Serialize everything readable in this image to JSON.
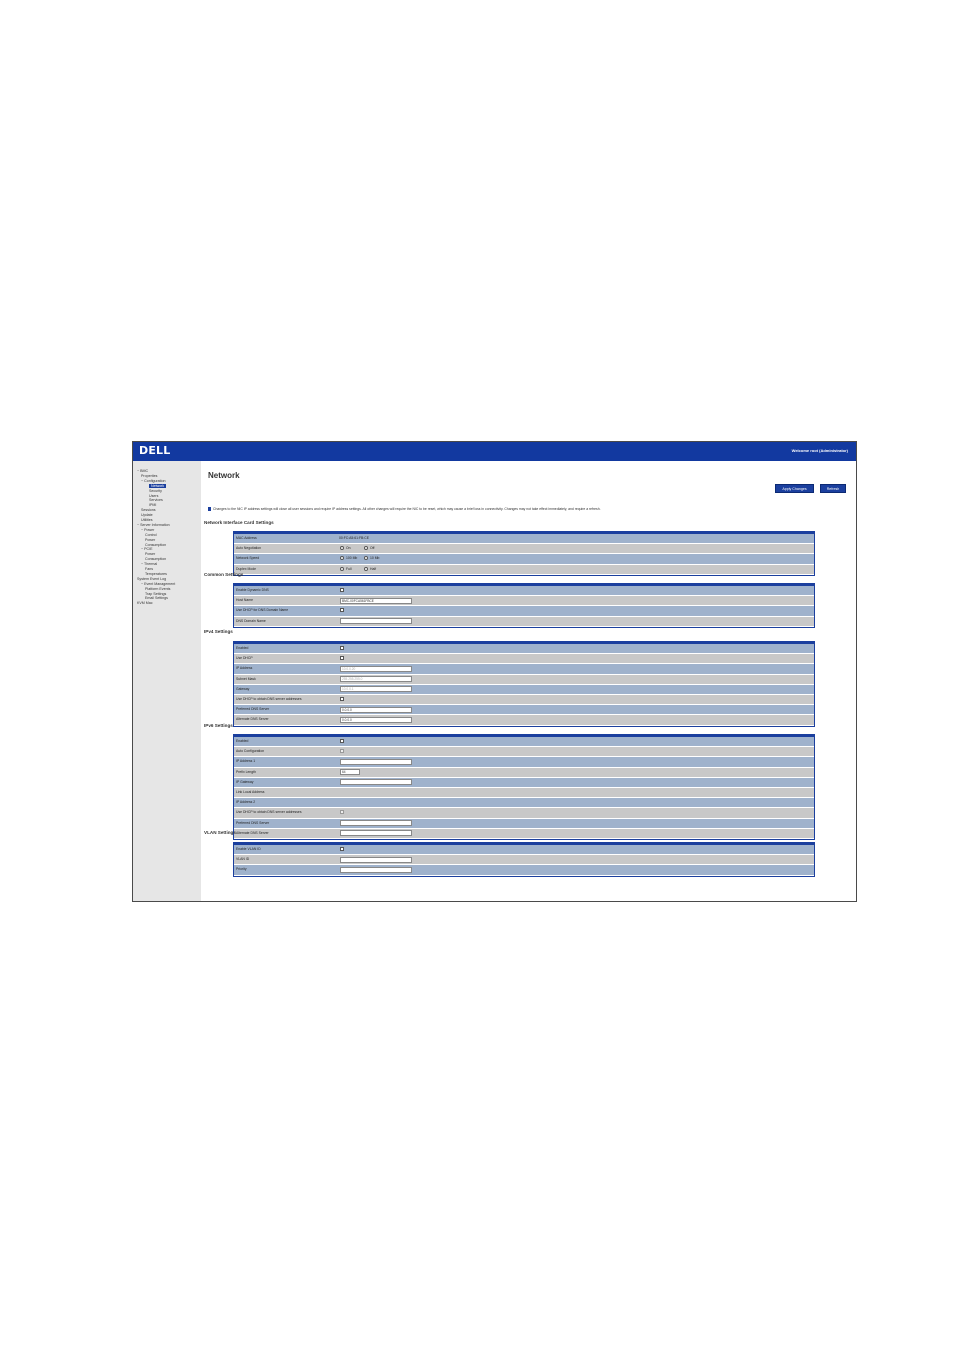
{
  "header": {
    "logo": "DELL",
    "welcome": "Welcome root (Administrator)"
  },
  "sidebar": {
    "items": [
      {
        "label": "− BMC",
        "indent": 0
      },
      {
        "label": "Properties",
        "indent": 1
      },
      {
        "label": "− Configuration",
        "indent": 1
      },
      {
        "label": "Network",
        "indent": 3,
        "active": true
      },
      {
        "label": "Security",
        "indent": 3
      },
      {
        "label": "Users",
        "indent": 3
      },
      {
        "label": "Services",
        "indent": 3
      },
      {
        "label": "IPMI",
        "indent": 3
      },
      {
        "label": "Sessions",
        "indent": 1
      },
      {
        "label": "Update",
        "indent": 1
      },
      {
        "label": "Utilities",
        "indent": 1
      },
      {
        "label": "− Server Information",
        "indent": 0
      },
      {
        "label": "− Power",
        "indent": 1
      },
      {
        "label": "Control",
        "indent": 2
      },
      {
        "label": "Power",
        "indent": 2
      },
      {
        "label": "Consumption",
        "indent": 2
      },
      {
        "label": "− PCIE",
        "indent": 1
      },
      {
        "label": "Power",
        "indent": 2
      },
      {
        "label": "Consumption",
        "indent": 2
      },
      {
        "label": "− Thermal",
        "indent": 1
      },
      {
        "label": "Fans",
        "indent": 2
      },
      {
        "label": "Temperatures",
        "indent": 2
      },
      {
        "label": "System Event Log",
        "indent": 0
      },
      {
        "label": "− Event Management",
        "indent": 1
      },
      {
        "label": "Platform Events",
        "indent": 2
      },
      {
        "label": "Trap Settings",
        "indent": 2
      },
      {
        "label": "Email Settings",
        "indent": 2
      },
      {
        "label": "KVM Mac",
        "indent": 0
      }
    ]
  },
  "main": {
    "title": "Network",
    "apply_label": "Apply Changes",
    "refresh_label": "Refresh",
    "notice": "Changes to the NIC IP address settings will close all user sessions and require IP address settings. All other changes will require the NIC to be reset, which may cause a brief loss in connectivity. Changes may not take effect immediately, and require a refresh."
  },
  "nic": {
    "title": "Network Interface Card Settings",
    "rows": [
      {
        "label": "MAC Address",
        "value": "00:FC:A5:61:FB:CE"
      },
      {
        "label": "Auto Negotiation",
        "on": "On",
        "off": "Off"
      },
      {
        "label": "Network Speed",
        "speed1": "100 Mb",
        "speed2": "10 Mb"
      },
      {
        "label": "Duplex Mode",
        "duplex1": "Full",
        "duplex2": "Half"
      }
    ]
  },
  "common": {
    "title": "Common Settings",
    "rows": [
      {
        "label": "Enable Dynamic DNS"
      },
      {
        "label": "Host Name",
        "value": "BMC-00FCA561FBCE"
      },
      {
        "label": "Use DHCP for DNS Domain Name"
      },
      {
        "label": "DNS Domain Name",
        "value": ""
      }
    ]
  },
  "ipv4": {
    "title": "IPv4 Settings",
    "rows": [
      {
        "label": "Enabled"
      },
      {
        "label": "Use DHCP"
      },
      {
        "label": "IP Address",
        "value": "10.0.0.20"
      },
      {
        "label": "Subnet Mask",
        "value": "255.255.255.0"
      },
      {
        "label": "Gateway",
        "value": "10.0.0.1"
      },
      {
        "label": "Use DHCP to obtain DNS server addresses"
      },
      {
        "label": "Preferred DNS Server",
        "value": "0.0.0.0"
      },
      {
        "label": "Alternate DNS Server",
        "value": "0.0.0.0"
      }
    ]
  },
  "ipv6": {
    "title": "IPv6 Settings",
    "rows": [
      {
        "label": "Enabled"
      },
      {
        "label": "Auto Configuration"
      },
      {
        "label": "IP Address 1",
        "value": ""
      },
      {
        "label": "Prefix Length",
        "value": "64"
      },
      {
        "label": "IP Gateway",
        "value": ""
      },
      {
        "label": "Link Local Address",
        "value": ""
      },
      {
        "label": "IP Address 2",
        "value": ""
      },
      {
        "label": "Use DHCP to obtain DNS server addresses"
      },
      {
        "label": "Preferred DNS Server",
        "value": ""
      },
      {
        "label": "Alternate DNS Server",
        "value": ""
      }
    ]
  },
  "vlan": {
    "title": "VLAN Settings",
    "rows": [
      {
        "label": "Enable VLAN ID"
      },
      {
        "label": "VLAN ID",
        "value": ""
      },
      {
        "label": "Priority",
        "value": ""
      }
    ]
  }
}
